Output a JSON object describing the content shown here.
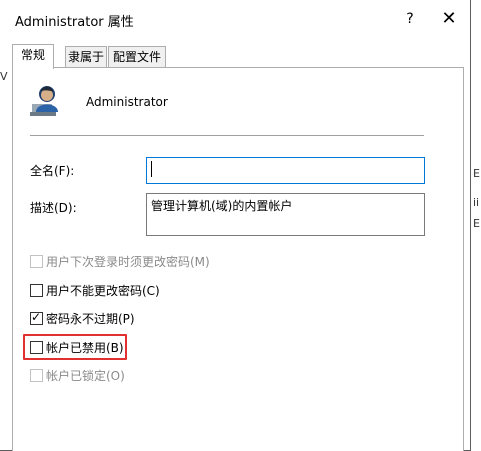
{
  "window": {
    "title": "Administrator 属性",
    "help_glyph": "?",
    "close_glyph": "✕"
  },
  "background": {
    "left_fragment": "V",
    "right_fragments": [
      "E",
      "ii",
      "E"
    ]
  },
  "tabs": [
    {
      "label": "常规",
      "active": true
    },
    {
      "label": "隶属于",
      "active": false
    },
    {
      "label": "配置文件",
      "active": false
    }
  ],
  "user": {
    "icon": "user-account-icon",
    "name": "Administrator"
  },
  "fields": {
    "full_name_label": "全名(F):",
    "full_name_value": "",
    "description_label": "描述(D):",
    "description_value": "管理计算机(域)的内置帐户"
  },
  "options": [
    {
      "label": "用户下次登录时须更改密码(M)",
      "checked": false,
      "enabled": false
    },
    {
      "label": "用户不能更改密码(C)",
      "checked": false,
      "enabled": true
    },
    {
      "label": "密码永不过期(P)",
      "checked": true,
      "enabled": true
    },
    {
      "label": "帐户已禁用(B)",
      "checked": false,
      "enabled": true
    },
    {
      "label": "帐户已锁定(O)",
      "checked": false,
      "enabled": false
    }
  ],
  "colors": {
    "highlight": "#e03030",
    "focus": "#0078d7"
  }
}
